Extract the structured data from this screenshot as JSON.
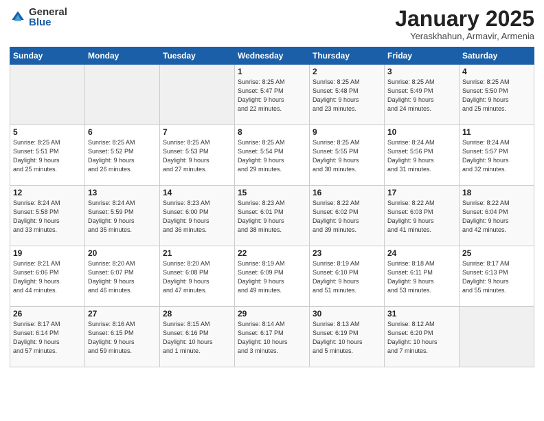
{
  "logo": {
    "general": "General",
    "blue": "Blue"
  },
  "header": {
    "month": "January 2025",
    "location": "Yeraskhahun, Armavir, Armenia"
  },
  "weekdays": [
    "Sunday",
    "Monday",
    "Tuesday",
    "Wednesday",
    "Thursday",
    "Friday",
    "Saturday"
  ],
  "weeks": [
    [
      {
        "day": "",
        "info": ""
      },
      {
        "day": "",
        "info": ""
      },
      {
        "day": "",
        "info": ""
      },
      {
        "day": "1",
        "info": "Sunrise: 8:25 AM\nSunset: 5:47 PM\nDaylight: 9 hours\nand 22 minutes."
      },
      {
        "day": "2",
        "info": "Sunrise: 8:25 AM\nSunset: 5:48 PM\nDaylight: 9 hours\nand 23 minutes."
      },
      {
        "day": "3",
        "info": "Sunrise: 8:25 AM\nSunset: 5:49 PM\nDaylight: 9 hours\nand 24 minutes."
      },
      {
        "day": "4",
        "info": "Sunrise: 8:25 AM\nSunset: 5:50 PM\nDaylight: 9 hours\nand 25 minutes."
      }
    ],
    [
      {
        "day": "5",
        "info": "Sunrise: 8:25 AM\nSunset: 5:51 PM\nDaylight: 9 hours\nand 25 minutes."
      },
      {
        "day": "6",
        "info": "Sunrise: 8:25 AM\nSunset: 5:52 PM\nDaylight: 9 hours\nand 26 minutes."
      },
      {
        "day": "7",
        "info": "Sunrise: 8:25 AM\nSunset: 5:53 PM\nDaylight: 9 hours\nand 27 minutes."
      },
      {
        "day": "8",
        "info": "Sunrise: 8:25 AM\nSunset: 5:54 PM\nDaylight: 9 hours\nand 29 minutes."
      },
      {
        "day": "9",
        "info": "Sunrise: 8:25 AM\nSunset: 5:55 PM\nDaylight: 9 hours\nand 30 minutes."
      },
      {
        "day": "10",
        "info": "Sunrise: 8:24 AM\nSunset: 5:56 PM\nDaylight: 9 hours\nand 31 minutes."
      },
      {
        "day": "11",
        "info": "Sunrise: 8:24 AM\nSunset: 5:57 PM\nDaylight: 9 hours\nand 32 minutes."
      }
    ],
    [
      {
        "day": "12",
        "info": "Sunrise: 8:24 AM\nSunset: 5:58 PM\nDaylight: 9 hours\nand 33 minutes."
      },
      {
        "day": "13",
        "info": "Sunrise: 8:24 AM\nSunset: 5:59 PM\nDaylight: 9 hours\nand 35 minutes."
      },
      {
        "day": "14",
        "info": "Sunrise: 8:23 AM\nSunset: 6:00 PM\nDaylight: 9 hours\nand 36 minutes."
      },
      {
        "day": "15",
        "info": "Sunrise: 8:23 AM\nSunset: 6:01 PM\nDaylight: 9 hours\nand 38 minutes."
      },
      {
        "day": "16",
        "info": "Sunrise: 8:22 AM\nSunset: 6:02 PM\nDaylight: 9 hours\nand 39 minutes."
      },
      {
        "day": "17",
        "info": "Sunrise: 8:22 AM\nSunset: 6:03 PM\nDaylight: 9 hours\nand 41 minutes."
      },
      {
        "day": "18",
        "info": "Sunrise: 8:22 AM\nSunset: 6:04 PM\nDaylight: 9 hours\nand 42 minutes."
      }
    ],
    [
      {
        "day": "19",
        "info": "Sunrise: 8:21 AM\nSunset: 6:06 PM\nDaylight: 9 hours\nand 44 minutes."
      },
      {
        "day": "20",
        "info": "Sunrise: 8:20 AM\nSunset: 6:07 PM\nDaylight: 9 hours\nand 46 minutes."
      },
      {
        "day": "21",
        "info": "Sunrise: 8:20 AM\nSunset: 6:08 PM\nDaylight: 9 hours\nand 47 minutes."
      },
      {
        "day": "22",
        "info": "Sunrise: 8:19 AM\nSunset: 6:09 PM\nDaylight: 9 hours\nand 49 minutes."
      },
      {
        "day": "23",
        "info": "Sunrise: 8:19 AM\nSunset: 6:10 PM\nDaylight: 9 hours\nand 51 minutes."
      },
      {
        "day": "24",
        "info": "Sunrise: 8:18 AM\nSunset: 6:11 PM\nDaylight: 9 hours\nand 53 minutes."
      },
      {
        "day": "25",
        "info": "Sunrise: 8:17 AM\nSunset: 6:13 PM\nDaylight: 9 hours\nand 55 minutes."
      }
    ],
    [
      {
        "day": "26",
        "info": "Sunrise: 8:17 AM\nSunset: 6:14 PM\nDaylight: 9 hours\nand 57 minutes."
      },
      {
        "day": "27",
        "info": "Sunrise: 8:16 AM\nSunset: 6:15 PM\nDaylight: 9 hours\nand 59 minutes."
      },
      {
        "day": "28",
        "info": "Sunrise: 8:15 AM\nSunset: 6:16 PM\nDaylight: 10 hours\nand 1 minute."
      },
      {
        "day": "29",
        "info": "Sunrise: 8:14 AM\nSunset: 6:17 PM\nDaylight: 10 hours\nand 3 minutes."
      },
      {
        "day": "30",
        "info": "Sunrise: 8:13 AM\nSunset: 6:19 PM\nDaylight: 10 hours\nand 5 minutes."
      },
      {
        "day": "31",
        "info": "Sunrise: 8:12 AM\nSunset: 6:20 PM\nDaylight: 10 hours\nand 7 minutes."
      },
      {
        "day": "",
        "info": ""
      }
    ]
  ]
}
